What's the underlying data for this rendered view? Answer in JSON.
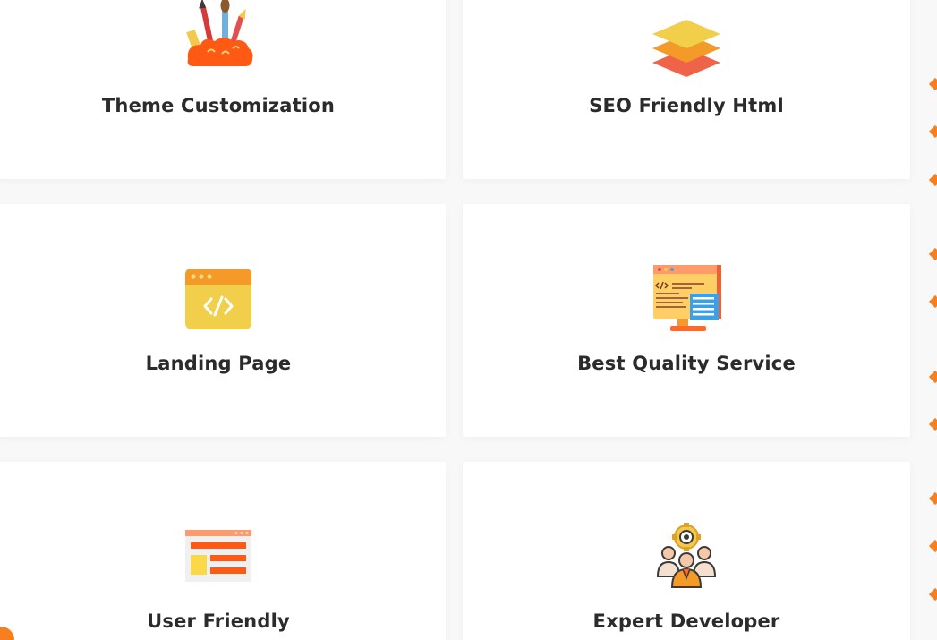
{
  "features": [
    {
      "id": "theme",
      "title": "Theme Customization",
      "icon": "paint-brushes-icon"
    },
    {
      "id": "seo",
      "title": "SEO Friendly Html",
      "icon": "layers-icon"
    },
    {
      "id": "landing",
      "title": "Landing Page",
      "icon": "code-window-icon"
    },
    {
      "id": "quality",
      "title": "Best Quality Service",
      "icon": "code-monitor-icon"
    },
    {
      "id": "user",
      "title": "User Friendly",
      "icon": "web-layout-icon"
    },
    {
      "id": "developer",
      "title": "Expert Developer",
      "icon": "team-gear-icon"
    }
  ],
  "colors": {
    "accent": "#f77f1e",
    "text": "#2b2b2b",
    "card_bg": "#ffffff",
    "page_bg": "#f8f8f9"
  }
}
